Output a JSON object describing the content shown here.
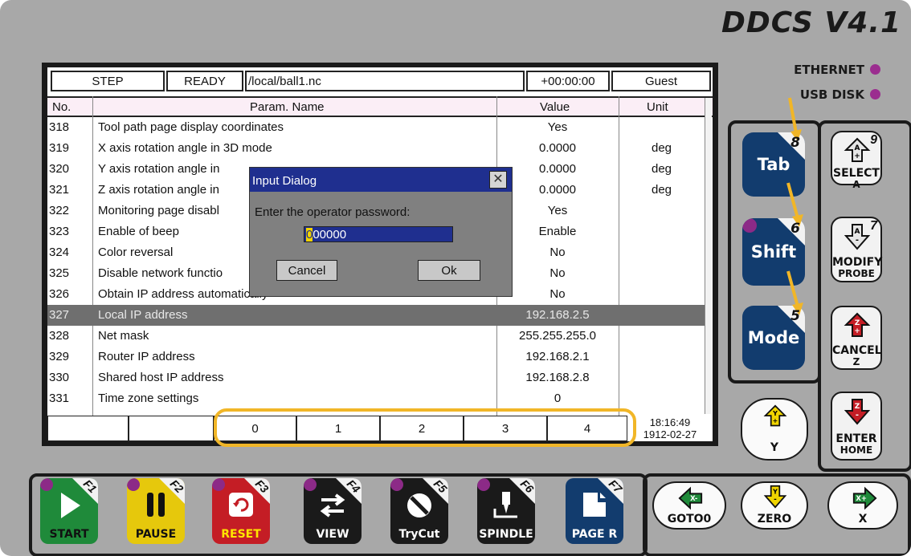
{
  "brand": "DDCS V4.1",
  "indicators": {
    "ethernet": "ETHERNET",
    "usb": "USB DISK"
  },
  "status": {
    "mode": "STEP",
    "state": "READY",
    "file": "/local/ball1.nc",
    "time": "+00:00:00",
    "user": "Guest"
  },
  "table": {
    "headers": {
      "no": "No.",
      "name": "Param. Name",
      "value": "Value",
      "unit": "Unit"
    },
    "rows": [
      {
        "no": "318",
        "name": "Tool path page display coordinates",
        "value": "Yes",
        "unit": ""
      },
      {
        "no": "319",
        "name": "X axis rotation angle in 3D mode",
        "value": "0.0000",
        "unit": "deg"
      },
      {
        "no": "320",
        "name": "Y axis rotation angle in",
        "value": "0.0000",
        "unit": "deg"
      },
      {
        "no": "321",
        "name": "Z axis rotation angle in",
        "value": "0.0000",
        "unit": "deg"
      },
      {
        "no": "322",
        "name": "Monitoring page disabl",
        "value": "Yes",
        "unit": ""
      },
      {
        "no": "323",
        "name": "Enable of beep",
        "value": "Enable",
        "unit": ""
      },
      {
        "no": "324",
        "name": "Color reversal",
        "value": "No",
        "unit": ""
      },
      {
        "no": "325",
        "name": "Disable network functio",
        "value": "No",
        "unit": ""
      },
      {
        "no": "326",
        "name": "Obtain IP address automatically",
        "value": "No",
        "unit": ""
      },
      {
        "no": "327",
        "name": "Local IP address",
        "value": "192.168.2.5",
        "unit": ""
      },
      {
        "no": "328",
        "name": "Net mask",
        "value": "255.255.255.0",
        "unit": ""
      },
      {
        "no": "329",
        "name": "Router IP address",
        "value": "192.168.2.1",
        "unit": ""
      },
      {
        "no": "330",
        "name": "Shared host IP address",
        "value": "192.168.2.8",
        "unit": ""
      },
      {
        "no": "331",
        "name": "Time zone settings",
        "value": "0",
        "unit": ""
      }
    ]
  },
  "softkeys": [
    "0",
    "1",
    "2",
    "3",
    "4"
  ],
  "clock": {
    "time": "18:16:49",
    "date": "1912-02-27"
  },
  "dialog": {
    "title": "Input Dialog",
    "prompt": "Enter the operator password:",
    "value_first": "0",
    "value_rest": "00000",
    "cancel": "Cancel",
    "ok": "Ok"
  },
  "side_keys": {
    "tab": {
      "label": "Tab",
      "num": "8"
    },
    "shift": {
      "label": "Shift",
      "num": "6"
    },
    "mode": {
      "label": "Mode",
      "num": "5"
    },
    "select": {
      "label": "SELECT",
      "sub": "A",
      "num": "9"
    },
    "modify": {
      "label": "MODIFY",
      "sub": "PROBE",
      "num": "7"
    },
    "cancel": {
      "label": "CANCEL",
      "sub": "Z"
    },
    "yplus": {
      "label": "Y"
    },
    "enter": {
      "label": "ENTER",
      "sub": "HOME"
    }
  },
  "bottom_keys": {
    "goto0": "GOTO0",
    "zero": "ZERO",
    "xplus": "X"
  },
  "fkeys": [
    {
      "label": "START",
      "num": "F1",
      "color": "#1f8a3a",
      "text": "#111111"
    },
    {
      "label": "PAUSE",
      "num": "F2",
      "color": "#e6c80c",
      "text": "#111111"
    },
    {
      "label": "RESET",
      "num": "F3",
      "color": "#c41d25",
      "text": "#ffe600"
    },
    {
      "label": "VIEW",
      "num": "F4",
      "color": "#1a1a1a",
      "text": "#ffffff"
    },
    {
      "label": "TryCut",
      "num": "F5",
      "color": "#1a1a1a",
      "text": "#ffffff"
    },
    {
      "label": "SPINDLE",
      "num": "F6",
      "color": "#1a1a1a",
      "text": "#ffffff"
    },
    {
      "label": "PAGE R",
      "num": "F7",
      "color": "#123c6e",
      "text": "#ffffff"
    }
  ],
  "colors": {
    "accent_arrow": "#f1b627",
    "lcd_select": "#6f6f6f",
    "dialog_title": "#1f2f8f",
    "led": "#9b2d8f"
  }
}
